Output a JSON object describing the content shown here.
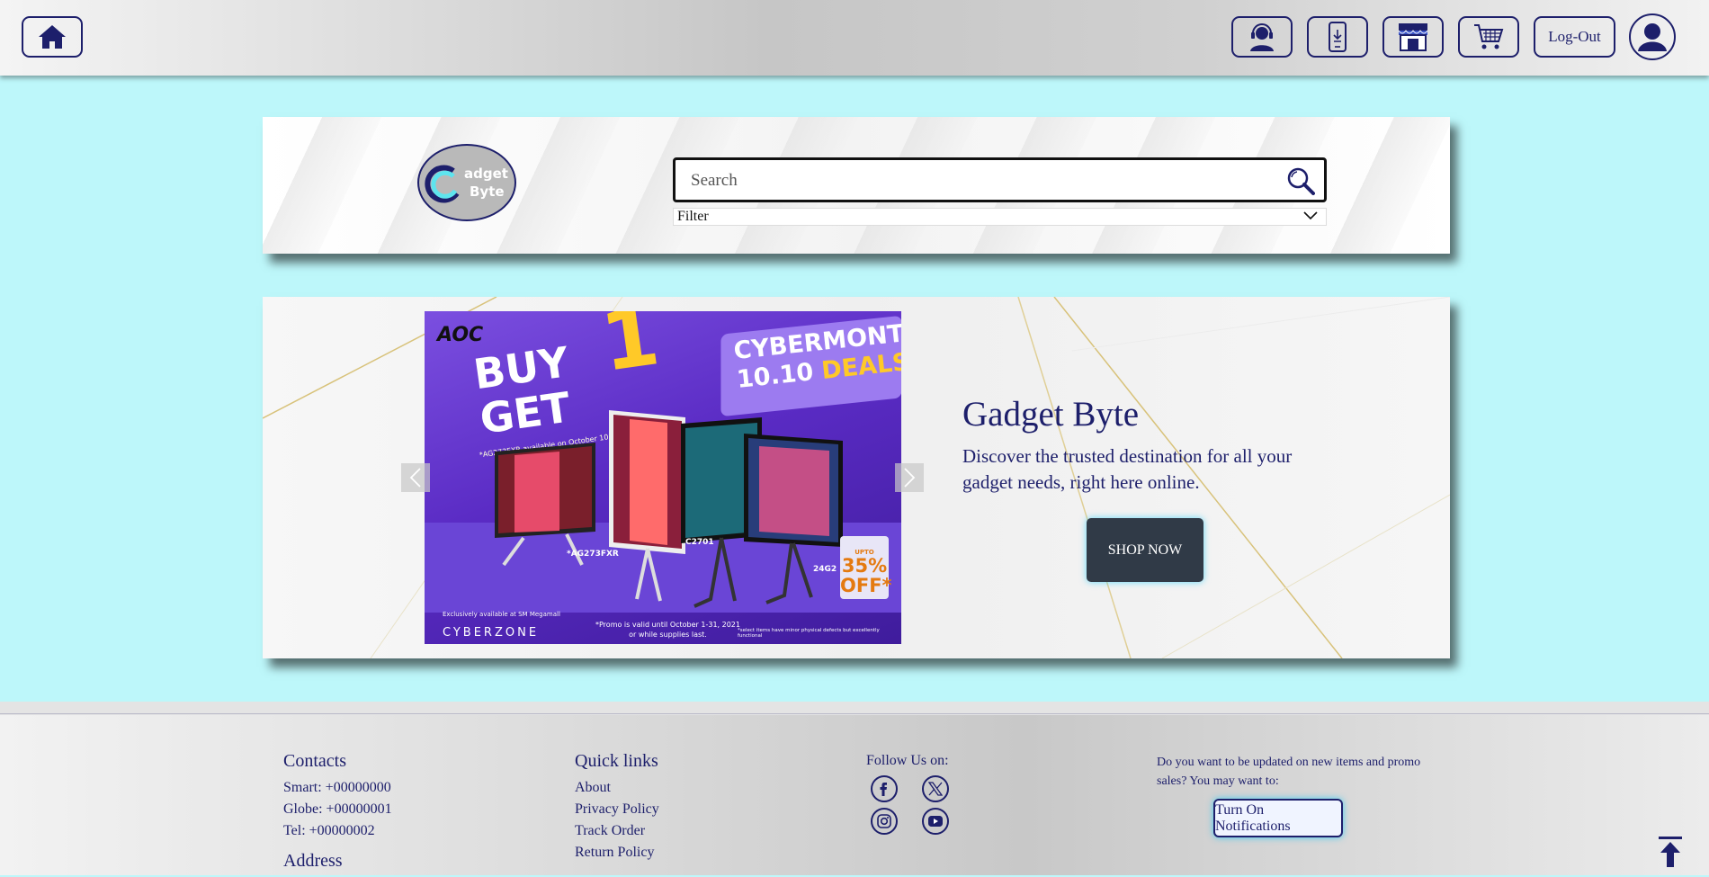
{
  "header": {
    "logout_label": "Log-Out"
  },
  "search": {
    "placeholder": "Search",
    "filter_label": "Filter"
  },
  "logo": {
    "line1": "adget",
    "line2": "Byte"
  },
  "hero": {
    "title": "Gadget Byte",
    "description": "Discover the trusted destination for all your gadget needs, right here online.",
    "shop_button": "SHOP NOW",
    "banner": {
      "brand": "AOC",
      "buy": "BUY",
      "one": "1",
      "get": "GET",
      "note": "*AG273FXR available on October 10, 2021 only*",
      "cyber_line1": "CYBERMONTH",
      "cyber_line2a": "10.10",
      "cyber_line2b": "DEALS",
      "badge_top": "UPTO",
      "badge_value": "35%",
      "badge_bottom": "OFF*",
      "model_1": "*AG273FXR",
      "model_2": "C2701",
      "model_3": "24G2",
      "exclusive": "Exclusively available at SM Megamall",
      "promo_valid_1": "*Promo is valid until October 1-31, 2021",
      "promo_valid_2": "or while supplies last.",
      "disclaimer": "*select items have minor physical defects but excellently functional",
      "cyberzone": "CYBERZONE"
    }
  },
  "footer": {
    "contacts": {
      "heading": "Contacts",
      "lines": [
        "Smart: +00000000",
        "Globe: +00000001",
        "Tel: +00000002"
      ],
      "address_heading": "Address"
    },
    "quick_links": {
      "heading": "Quick links",
      "links": [
        "About",
        "Privacy Policy",
        "Track Order",
        "Return Policy"
      ]
    },
    "follow": {
      "heading": "Follow Us on:",
      "icons": [
        "facebook-icon",
        "x-icon",
        "instagram-icon",
        "youtube-icon"
      ]
    },
    "notify": {
      "text": "Do you want to be updated on new items and promo sales? You may want to:",
      "button": "Turn On Notifications"
    }
  },
  "colors": {
    "primary": "#1d1f6b",
    "background": "#bdf7fa",
    "shop_button": "#303a47",
    "banner_purple": "#5a2bc4",
    "banner_yellow": "#ffc928"
  }
}
